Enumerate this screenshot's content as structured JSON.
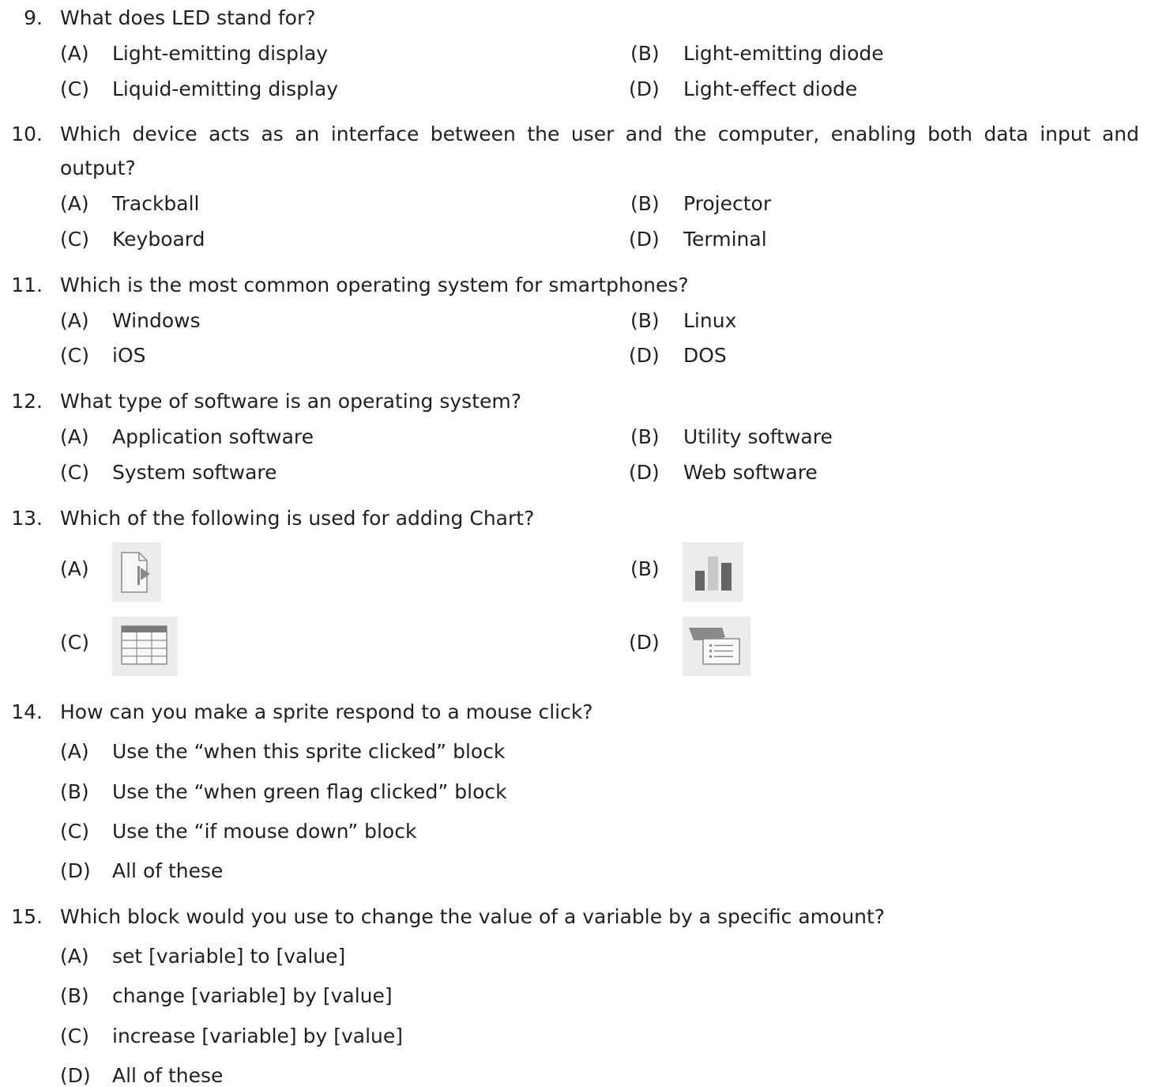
{
  "questions": [
    {
      "number": "9.",
      "text": "What does LED stand for?",
      "options": [
        {
          "key": "(A)",
          "text": "Light-emitting display"
        },
        {
          "key": "(B)",
          "text": "Light-emitting diode"
        },
        {
          "key": "(C)",
          "text": "Liquid-emitting display"
        },
        {
          "key": "(D)",
          "text": "Light-effect diode"
        }
      ]
    },
    {
      "number": "10.",
      "text_line1": "Which device acts as an interface between the user and the computer, enabling both data input and",
      "text_line2": "output?",
      "options": [
        {
          "key": "(A)",
          "text": "Trackball"
        },
        {
          "key": "(B)",
          "text": "Projector"
        },
        {
          "key": "(C)",
          "text": "Keyboard"
        },
        {
          "key": "(D)",
          "text": "Terminal"
        }
      ]
    },
    {
      "number": "11.",
      "text": "Which is the most common operating system for smartphones?",
      "options": [
        {
          "key": "(A)",
          "text": "Windows"
        },
        {
          "key": "(B)",
          "text": "Linux"
        },
        {
          "key": "(C)",
          "text": "iOS"
        },
        {
          "key": "(D)",
          "text": "DOS"
        }
      ]
    },
    {
      "number": "12.",
      "text": "What type of software is an operating system?",
      "options": [
        {
          "key": "(A)",
          "text": "Application software"
        },
        {
          "key": "(B)",
          "text": "Utility software"
        },
        {
          "key": "(C)",
          "text": "System software"
        },
        {
          "key": "(D)",
          "text": "Web software"
        }
      ]
    },
    {
      "number": "13.",
      "text": "Which of the following is used for adding Chart?",
      "options": [
        {
          "key": "(A)",
          "icon": "media-file-icon"
        },
        {
          "key": "(B)",
          "icon": "bar-chart-icon"
        },
        {
          "key": "(C)",
          "icon": "table-icon"
        },
        {
          "key": "(D)",
          "icon": "slide-layout-icon"
        }
      ]
    },
    {
      "number": "14.",
      "text": "How can you make a sprite respond to a mouse click?",
      "options": [
        {
          "key": "(A)",
          "text": "Use the “when this sprite clicked” block"
        },
        {
          "key": "(B)",
          "text": "Use the “when green flag clicked” block"
        },
        {
          "key": "(C)",
          "text": "Use the “if mouse down” block"
        },
        {
          "key": "(D)",
          "text": "All of these"
        }
      ]
    },
    {
      "number": "15.",
      "text": "Which block would you use to change the value of a variable by a specific amount?",
      "options": [
        {
          "key": "(A)",
          "text": "set [variable] to [value]"
        },
        {
          "key": "(B)",
          "text": "change [variable] by [value]"
        },
        {
          "key": "(C)",
          "text": "increase [variable] by [value]"
        },
        {
          "key": "(D)",
          "text": "All of these"
        }
      ]
    }
  ]
}
